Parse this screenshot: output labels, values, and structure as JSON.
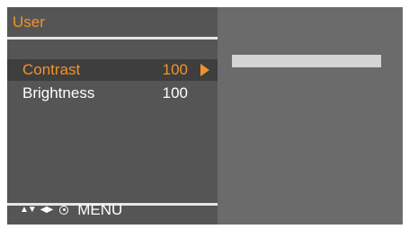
{
  "header": {
    "title": "User"
  },
  "menu": {
    "items": [
      {
        "label": "Contrast",
        "value": "100",
        "selected": true
      },
      {
        "label": "Brightness",
        "value": "100",
        "selected": false
      }
    ]
  },
  "slider": {
    "level": 1.0
  },
  "footer": {
    "up_down_icon": "up-down-arrows",
    "left_right_icon": "left-right-arrows",
    "ok_icon": "circle-dot",
    "menu_label": "MENU"
  },
  "colors": {
    "accent": "#f0922a",
    "background": "#555555",
    "right_panel": "#6b6b6b",
    "selected_row": "#3e3e3e",
    "slider": "#d4d4d4"
  }
}
